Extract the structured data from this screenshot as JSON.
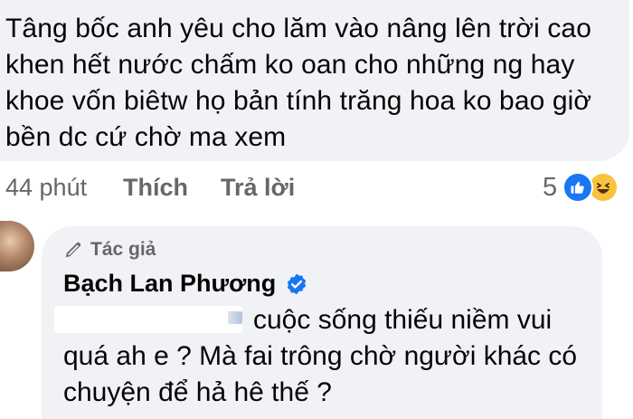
{
  "comment_top": {
    "text": "Tâng bốc anh yêu cho lăm vào nâng lên trời cao khen hết nước chấm ko oan cho những ng hay khoe vốn biêtw họ bản tính trăng hoa ko bao giờ bền dc cứ chờ ma xem"
  },
  "actions": {
    "time": "44 phút",
    "like": "Thích",
    "reply": "Trả lời",
    "reaction_count": "5"
  },
  "reactions": [
    "like-icon",
    "haha-icon"
  ],
  "colors": {
    "bubble": "#f0f2f5",
    "meta_text": "#65676b",
    "like_blue": "#1877f2",
    "haha_yellow": "#f7c33b"
  },
  "reply": {
    "author_tag": "Tác giả",
    "author_name": "Bạch Lan Phương",
    "text": "cuộc sống thiếu niềm vui quá ah e ? Mà fai trông chờ người khác có chuyện để hả hê thế ?"
  }
}
